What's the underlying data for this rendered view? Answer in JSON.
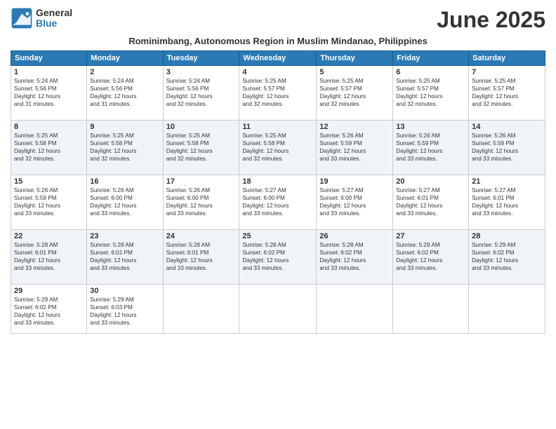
{
  "logo": {
    "general": "General",
    "blue": "Blue"
  },
  "title": "June 2025",
  "subtitle": "Rominimbang, Autonomous Region in Muslim Mindanao, Philippines",
  "days_of_week": [
    "Sunday",
    "Monday",
    "Tuesday",
    "Wednesday",
    "Thursday",
    "Friday",
    "Saturday"
  ],
  "weeks": [
    [
      {
        "day": "1",
        "info": "Sunrise: 5:24 AM\nSunset: 5:56 PM\nDaylight: 12 hours\nand 31 minutes."
      },
      {
        "day": "2",
        "info": "Sunrise: 5:24 AM\nSunset: 5:56 PM\nDaylight: 12 hours\nand 31 minutes."
      },
      {
        "day": "3",
        "info": "Sunrise: 5:24 AM\nSunset: 5:56 PM\nDaylight: 12 hours\nand 32 minutes."
      },
      {
        "day": "4",
        "info": "Sunrise: 5:25 AM\nSunset: 5:57 PM\nDaylight: 12 hours\nand 32 minutes."
      },
      {
        "day": "5",
        "info": "Sunrise: 5:25 AM\nSunset: 5:57 PM\nDaylight: 12 hours\nand 32 minutes."
      },
      {
        "day": "6",
        "info": "Sunrise: 5:25 AM\nSunset: 5:57 PM\nDaylight: 12 hours\nand 32 minutes."
      },
      {
        "day": "7",
        "info": "Sunrise: 5:25 AM\nSunset: 5:57 PM\nDaylight: 12 hours\nand 32 minutes."
      }
    ],
    [
      {
        "day": "8",
        "info": "Sunrise: 5:25 AM\nSunset: 5:58 PM\nDaylight: 12 hours\nand 32 minutes."
      },
      {
        "day": "9",
        "info": "Sunrise: 5:25 AM\nSunset: 5:58 PM\nDaylight: 12 hours\nand 32 minutes."
      },
      {
        "day": "10",
        "info": "Sunrise: 5:25 AM\nSunset: 5:58 PM\nDaylight: 12 hours\nand 32 minutes."
      },
      {
        "day": "11",
        "info": "Sunrise: 5:25 AM\nSunset: 5:58 PM\nDaylight: 12 hours\nand 32 minutes."
      },
      {
        "day": "12",
        "info": "Sunrise: 5:26 AM\nSunset: 5:59 PM\nDaylight: 12 hours\nand 33 minutes."
      },
      {
        "day": "13",
        "info": "Sunrise: 5:26 AM\nSunset: 5:59 PM\nDaylight: 12 hours\nand 33 minutes."
      },
      {
        "day": "14",
        "info": "Sunrise: 5:26 AM\nSunset: 5:59 PM\nDaylight: 12 hours\nand 33 minutes."
      }
    ],
    [
      {
        "day": "15",
        "info": "Sunrise: 5:26 AM\nSunset: 5:59 PM\nDaylight: 12 hours\nand 33 minutes."
      },
      {
        "day": "16",
        "info": "Sunrise: 5:26 AM\nSunset: 6:00 PM\nDaylight: 12 hours\nand 33 minutes."
      },
      {
        "day": "17",
        "info": "Sunrise: 5:26 AM\nSunset: 6:00 PM\nDaylight: 12 hours\nand 33 minutes."
      },
      {
        "day": "18",
        "info": "Sunrise: 5:27 AM\nSunset: 6:00 PM\nDaylight: 12 hours\nand 33 minutes."
      },
      {
        "day": "19",
        "info": "Sunrise: 5:27 AM\nSunset: 6:00 PM\nDaylight: 12 hours\nand 33 minutes."
      },
      {
        "day": "20",
        "info": "Sunrise: 5:27 AM\nSunset: 6:01 PM\nDaylight: 12 hours\nand 33 minutes."
      },
      {
        "day": "21",
        "info": "Sunrise: 5:27 AM\nSunset: 6:01 PM\nDaylight: 12 hours\nand 33 minutes."
      }
    ],
    [
      {
        "day": "22",
        "info": "Sunrise: 5:28 AM\nSunset: 6:01 PM\nDaylight: 12 hours\nand 33 minutes."
      },
      {
        "day": "23",
        "info": "Sunrise: 5:28 AM\nSunset: 6:01 PM\nDaylight: 12 hours\nand 33 minutes."
      },
      {
        "day": "24",
        "info": "Sunrise: 5:28 AM\nSunset: 6:01 PM\nDaylight: 12 hours\nand 33 minutes."
      },
      {
        "day": "25",
        "info": "Sunrise: 5:28 AM\nSunset: 6:02 PM\nDaylight: 12 hours\nand 33 minutes."
      },
      {
        "day": "26",
        "info": "Sunrise: 5:28 AM\nSunset: 6:02 PM\nDaylight: 12 hours\nand 33 minutes."
      },
      {
        "day": "27",
        "info": "Sunrise: 5:29 AM\nSunset: 6:02 PM\nDaylight: 12 hours\nand 33 minutes."
      },
      {
        "day": "28",
        "info": "Sunrise: 5:29 AM\nSunset: 6:02 PM\nDaylight: 12 hours\nand 33 minutes."
      }
    ],
    [
      {
        "day": "29",
        "info": "Sunrise: 5:29 AM\nSunset: 6:02 PM\nDaylight: 12 hours\nand 33 minutes."
      },
      {
        "day": "30",
        "info": "Sunrise: 5:29 AM\nSunset: 6:03 PM\nDaylight: 12 hours\nand 33 minutes."
      },
      {
        "day": "",
        "info": ""
      },
      {
        "day": "",
        "info": ""
      },
      {
        "day": "",
        "info": ""
      },
      {
        "day": "",
        "info": ""
      },
      {
        "day": "",
        "info": ""
      }
    ]
  ]
}
